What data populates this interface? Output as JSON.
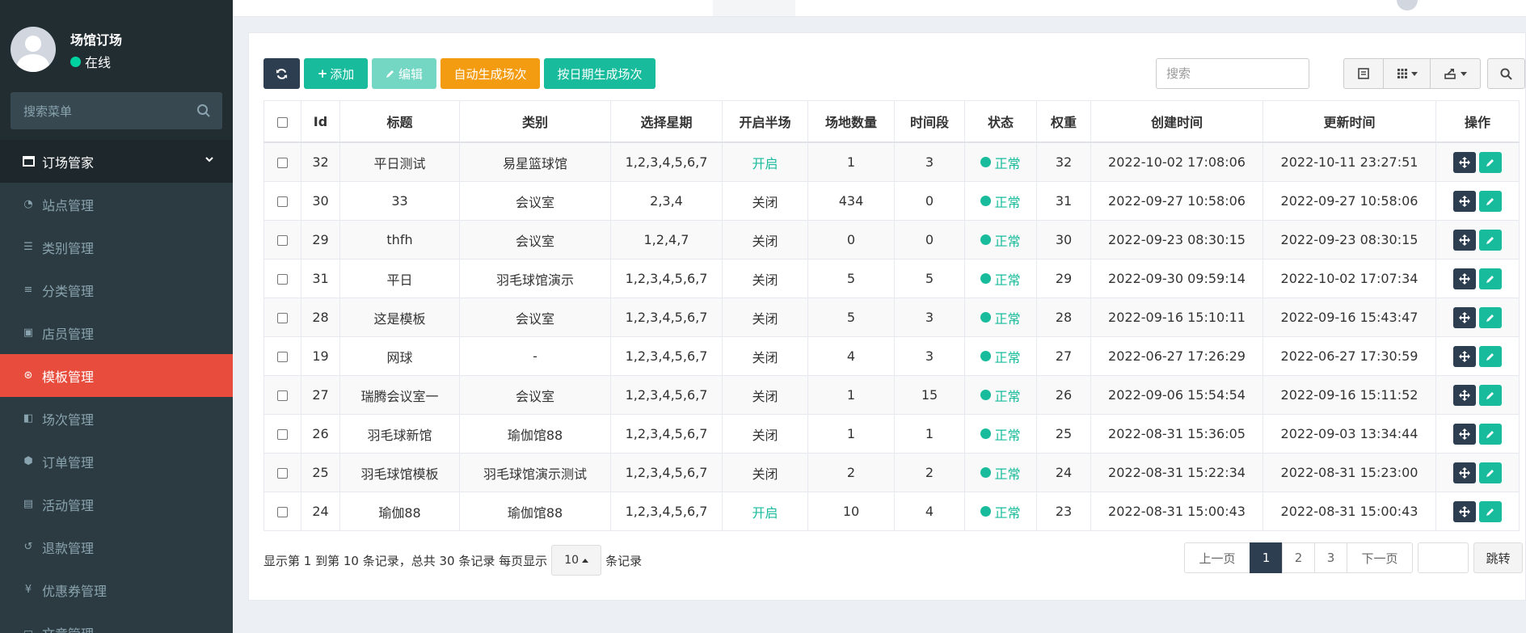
{
  "sidebar": {
    "user": {
      "name": "场馆订场",
      "status": "在线"
    },
    "search_placeholder": "搜索菜单",
    "menu_header": "订场管家",
    "items": [
      {
        "label": "站点管理",
        "icon": "dashboard-icon"
      },
      {
        "label": "类别管理",
        "icon": "list-icon"
      },
      {
        "label": "分类管理",
        "icon": "bars-icon"
      },
      {
        "label": "店员管理",
        "icon": "id-card-icon"
      },
      {
        "label": "模板管理",
        "icon": "dribbble-icon",
        "active": true
      },
      {
        "label": "场次管理",
        "icon": "th-icon"
      },
      {
        "label": "订单管理",
        "icon": "cube-icon"
      },
      {
        "label": "活动管理",
        "icon": "gift-icon"
      },
      {
        "label": "退款管理",
        "icon": "undo-icon"
      },
      {
        "label": "优惠券管理",
        "icon": "yen-icon"
      },
      {
        "label": "文章管理",
        "icon": "file-icon"
      }
    ]
  },
  "toolbar": {
    "add": "添加",
    "edit": "编辑",
    "auto_generate": "自动生成场次",
    "date_generate": "按日期生成场次",
    "search_placeholder": "搜索"
  },
  "table": {
    "headers": [
      "Id",
      "标题",
      "类别",
      "选择星期",
      "开启半场",
      "场地数量",
      "时间段",
      "状态",
      "权重",
      "创建时间",
      "更新时间",
      "操作"
    ],
    "rows": [
      {
        "id": "32",
        "title": "平日测试",
        "category": "易星篮球馆",
        "weekdays": "1,2,3,4,5,6,7",
        "half": "开启",
        "courts": "1",
        "slots": "3",
        "status": "正常",
        "weight": "32",
        "created": "2022-10-02 17:08:06",
        "updated": "2022-10-11 23:27:51"
      },
      {
        "id": "30",
        "title": "33",
        "category": "会议室",
        "weekdays": "2,3,4",
        "half": "关闭",
        "courts": "434",
        "slots": "0",
        "status": "正常",
        "weight": "31",
        "created": "2022-09-27 10:58:06",
        "updated": "2022-09-27 10:58:06"
      },
      {
        "id": "29",
        "title": "thfh",
        "category": "会议室",
        "weekdays": "1,2,4,7",
        "half": "关闭",
        "courts": "0",
        "slots": "0",
        "status": "正常",
        "weight": "30",
        "created": "2022-09-23 08:30:15",
        "updated": "2022-09-23 08:30:15"
      },
      {
        "id": "31",
        "title": "平日",
        "category": "羽毛球馆演示",
        "weekdays": "1,2,3,4,5,6,7",
        "half": "关闭",
        "courts": "5",
        "slots": "5",
        "status": "正常",
        "weight": "29",
        "created": "2022-09-30 09:59:14",
        "updated": "2022-10-02 17:07:34"
      },
      {
        "id": "28",
        "title": "这是模板",
        "category": "会议室",
        "weekdays": "1,2,3,4,5,6,7",
        "half": "关闭",
        "courts": "5",
        "slots": "3",
        "status": "正常",
        "weight": "28",
        "created": "2022-09-16 15:10:11",
        "updated": "2022-09-16 15:43:47"
      },
      {
        "id": "19",
        "title": "网球",
        "category": "-",
        "weekdays": "1,2,3,4,5,6,7",
        "half": "关闭",
        "courts": "4",
        "slots": "3",
        "status": "正常",
        "weight": "27",
        "created": "2022-06-27 17:26:29",
        "updated": "2022-06-27 17:30:59"
      },
      {
        "id": "27",
        "title": "瑞腾会议室一",
        "category": "会议室",
        "weekdays": "1,2,3,4,5,6,7",
        "half": "关闭",
        "courts": "1",
        "slots": "15",
        "status": "正常",
        "weight": "26",
        "created": "2022-09-06 15:54:54",
        "updated": "2022-09-16 15:11:52"
      },
      {
        "id": "26",
        "title": "羽毛球新馆",
        "category": "瑜伽馆88",
        "weekdays": "1,2,3,4,5,6,7",
        "half": "关闭",
        "courts": "1",
        "slots": "1",
        "status": "正常",
        "weight": "25",
        "created": "2022-08-31 15:36:05",
        "updated": "2022-09-03 13:34:44"
      },
      {
        "id": "25",
        "title": "羽毛球馆模板",
        "category": "羽毛球馆演示测试",
        "weekdays": "1,2,3,4,5,6,7",
        "half": "关闭",
        "courts": "2",
        "slots": "2",
        "status": "正常",
        "weight": "24",
        "created": "2022-08-31 15:22:34",
        "updated": "2022-08-31 15:23:00"
      },
      {
        "id": "24",
        "title": "瑜伽88",
        "category": "瑜伽馆88",
        "weekdays": "1,2,3,4,5,6,7",
        "half": "开启",
        "courts": "10",
        "slots": "4",
        "status": "正常",
        "weight": "23",
        "created": "2022-08-31 15:00:43",
        "updated": "2022-08-31 15:00:43"
      }
    ]
  },
  "pager": {
    "info_prefix": "显示第 1 到第 10 条记录，总共 30 条记录 每页显示",
    "page_size": "10",
    "info_suffix": "条记录",
    "prev": "上一页",
    "pages": [
      "1",
      "2",
      "3"
    ],
    "current": "1",
    "next": "下一页",
    "jump": "跳转"
  },
  "colors": {
    "sidebar_bg": "#222d32",
    "active_menu": "#e74c3c",
    "primary": "#18bc9c",
    "dark": "#2c3e50",
    "warning": "#f39c12"
  }
}
